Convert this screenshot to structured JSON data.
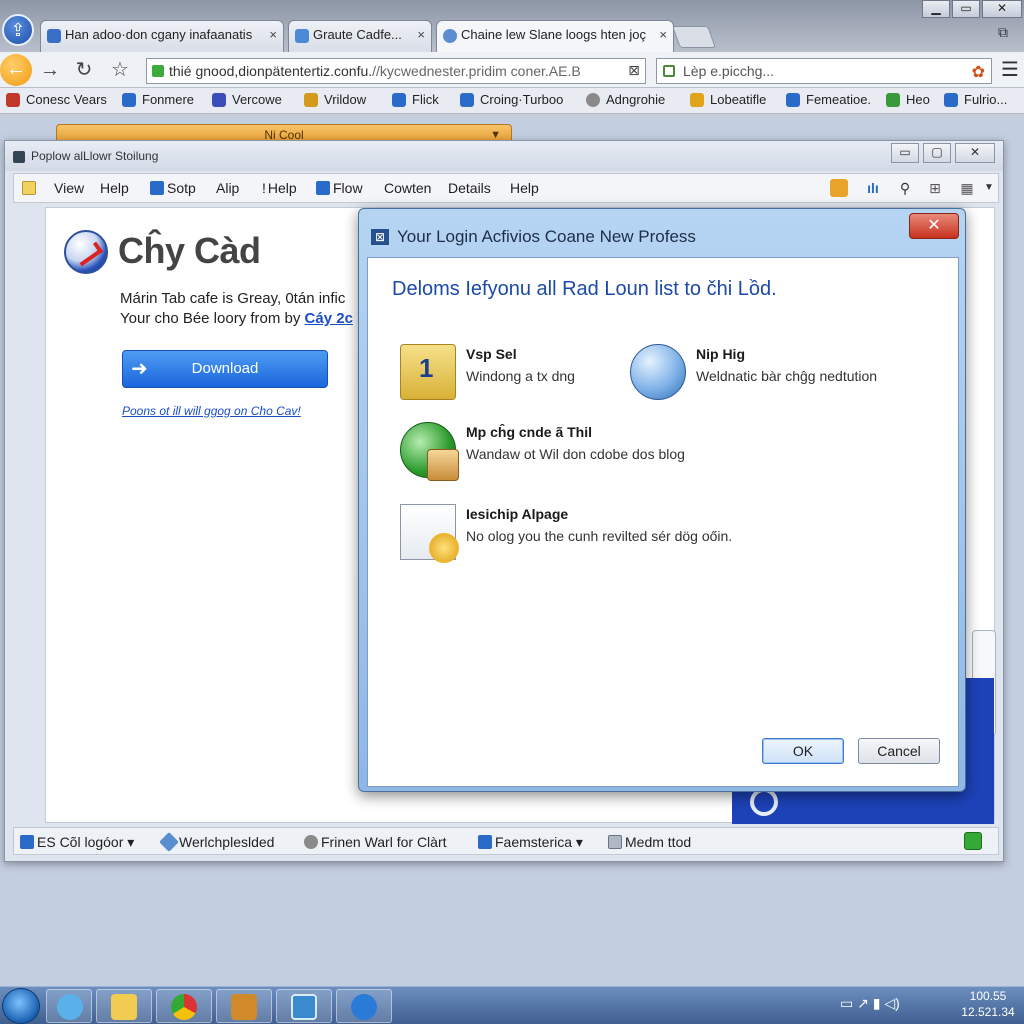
{
  "browser": {
    "tabs": [
      {
        "label": "Han adoo·don cgany inafaanatis",
        "close": "×"
      },
      {
        "label": "Graute Cadfe...",
        "close": "×"
      },
      {
        "label": "Chaine lew Slane loogs hten joç",
        "close": "×"
      }
    ],
    "window_controls": {
      "minimize": "▁",
      "maximize": "▭",
      "close": "✕",
      "restore": "⧉"
    },
    "url": "thié gnood,dionpätentertiz.confu.",
    "url_rest": "//kycwednester.pridim coner.AE.B",
    "search_placeholder": "Lèp e.picchg...",
    "bookmarks": [
      {
        "label": "Conesc Vears",
        "color": "#c0392b"
      },
      {
        "label": "Fonmere",
        "color": "#2a6ac8"
      },
      {
        "label": "Vercowe",
        "color": "#3a4fb8"
      },
      {
        "label": "Vrildow",
        "color": "#d49a1c"
      },
      {
        "label": "Flick",
        "color": "#2a6ac8"
      },
      {
        "label": "Croing·Turboo",
        "color": "#2a6ac8"
      },
      {
        "label": "Adngrohie",
        "color": "#8a8a8a"
      },
      {
        "label": "Lobeatifle",
        "color": "#e0a418"
      },
      {
        "label": "Femeatioe.",
        "color": "#2a6ac8"
      },
      {
        "label": "Heo",
        "color": "#3a9a3a"
      },
      {
        "label": "Fulrio...",
        "color": "#2a6ac8"
      }
    ]
  },
  "background": {
    "bar_label": "Ni Cool"
  },
  "app": {
    "title": "Poplow alLlowr Stoilung",
    "controls": {
      "minimize": "▭",
      "maximize": "▢",
      "close": "✕"
    },
    "menu": [
      "View",
      "Help",
      "Sotp",
      "Alip",
      "Help",
      "Flow",
      "Cowten",
      "Details",
      "Help"
    ],
    "site_name": "Cĥy Càd",
    "desc1": "Márin Tab cafe is Greay, 0tán infic",
    "desc2_prefix": "Your cho Bée loory from by ",
    "desc2_link": "Cáy 2c",
    "download_label": "Download",
    "download_arrow": "➜",
    "small_link": "Poons ot ill will ggog on Cho Cav!",
    "status": [
      "ES Cõl logóor ▾",
      "Werlchpleslded",
      "Frinen Warl for Clàrt",
      "Faemsterica ▾",
      "Medm ttod"
    ]
  },
  "dialog": {
    "title": "Your Login Acfivios Coane New Profess",
    "close": "✕",
    "icon": "⊠",
    "heading": "Deloms Iefyonu all Rad Loun list to čhi Lồd.",
    "options": [
      {
        "title": "Vsp Sel",
        "desc": "Windong a tx dng",
        "icon": "folder-icon"
      },
      {
        "title": "Nip Hig",
        "desc": "Weldnatic bàr chĝg nedtution",
        "icon": "globe-icon"
      },
      {
        "title": "Mp cĥg cnde ã Thil",
        "desc": "Wandaw ot Wil don cdobe dos blog",
        "icon": "shield-icon"
      },
      {
        "title": "Iesichip Alpage",
        "desc": "No olog you the cunh revilted sér dög oőin.",
        "icon": "document-icon"
      }
    ],
    "ok_label": "OK",
    "cancel_label": "Cancel"
  },
  "taskbar": {
    "tray": "▭ ↗ ▮ ◁)",
    "time": "100.55",
    "date": "12.521.34"
  }
}
